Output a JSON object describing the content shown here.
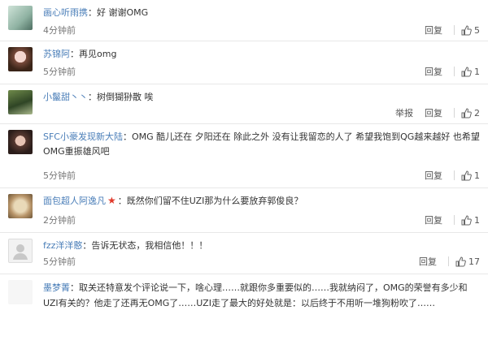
{
  "comments": [
    {
      "username": "画心听雨携",
      "text": "好 谢谢OMG",
      "time": "4分钟前",
      "actions": [
        "回复"
      ],
      "likes": "5"
    },
    {
      "username": "苏锦阿",
      "text": "再见omg",
      "time": "5分钟前",
      "actions": [
        "回复"
      ],
      "likes": "1"
    },
    {
      "username": "小鬣甜丶丶",
      "text": "树倒猢狲散 唉",
      "time": "",
      "actions": [
        "举报",
        "回复"
      ],
      "likes": "2"
    },
    {
      "username": "SFC小豪发现新大陆",
      "text": "OMG 酷儿还在 夕阳还在 除此之外 没有让我留恋的人了 希望我饱到QG越来越好 也希望OMG重振雄风吧",
      "time": "5分钟前",
      "actions": [
        "回复"
      ],
      "likes": "1"
    },
    {
      "username": "面包超人阿逸凡",
      "badge": "★",
      "text": "既然你们留不住UZI那为什么要放弃郭俊良？",
      "time": "2分钟前",
      "actions": [
        "回复"
      ],
      "likes": "1"
    },
    {
      "username": "fzz洋洋憨",
      "text": "告诉无状态，我相信他！！！",
      "time": "5分钟前",
      "actions": [
        "回复"
      ],
      "likes": "17"
    },
    {
      "username": "墨梦菁",
      "text": "取关还特意发个评论说一下，啥心理……就跟你多重要似的……我就纳闷了，OMG的荣誉有多少和UZI有关的？他走了还再无OMG了……UZI走了最大的好处就是：以后终于不用听一堆狗粉吹了……",
      "time": "",
      "actions": [],
      "likes": ""
    }
  ],
  "icons": {
    "like": "thumbs-up-icon",
    "star": "star-icon"
  },
  "colors": {
    "username": "#4a7eb8",
    "star": "#e03a2b"
  }
}
